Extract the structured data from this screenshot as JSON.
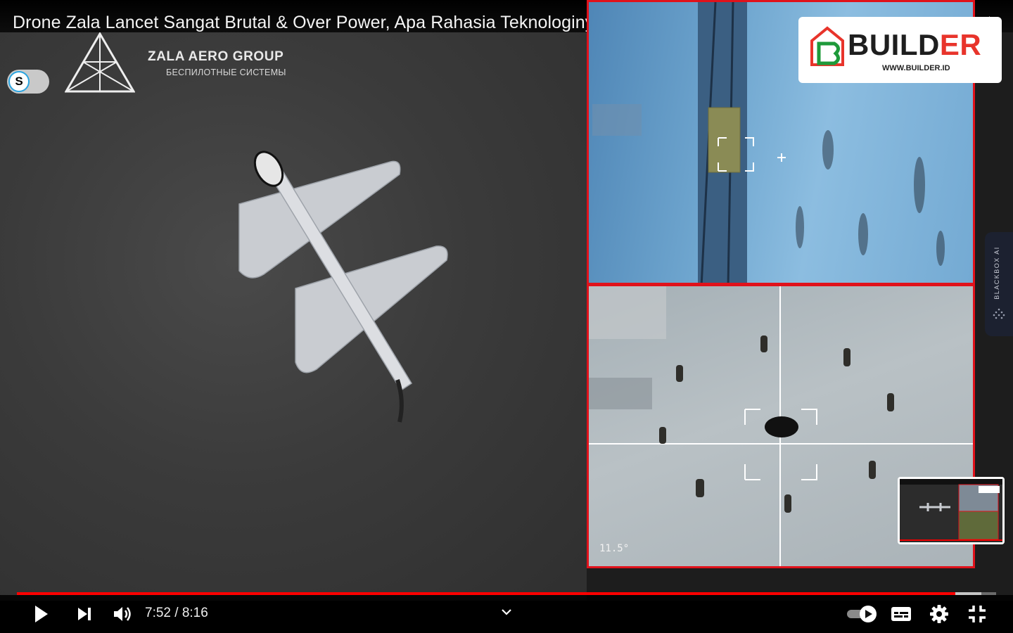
{
  "video": {
    "title": "Drone Zala Lancet Sangat Brutal & Over Power, Apa Rahasia Teknologinya?",
    "current_time": "7:52",
    "duration": "8:16",
    "time_display": "7:52 / 8:16",
    "progress": 0.958,
    "buffered": 0.985
  },
  "overlay": {
    "brand_name": "ZALA AERO GROUP",
    "brand_subtitle": "БЕСПИЛОТНЫЕ СИСТЕМЫ",
    "toggle_letter": "S",
    "sponsor_main": "BUILD",
    "sponsor_accent": "ER",
    "sponsor_url": "WWW.BUILDER.ID",
    "altitude": "11.5°",
    "side_panel_label": "BLACKBOX AI"
  },
  "icons": {
    "watch_later": "clock-icon",
    "share": "share-arrow-icon",
    "play": "play-icon",
    "next": "next-icon",
    "volume": "volume-icon",
    "chapters": "chevron-down-icon",
    "autoplay": "autoplay-toggle-icon",
    "subtitles": "subtitles-icon",
    "settings": "gear-icon",
    "fullscreen_exit": "exit-fullscreen-icon"
  },
  "colors": {
    "progress": "#ff0000",
    "feed_border": "#e0121b",
    "sponsor_accent": "#e8342b"
  }
}
